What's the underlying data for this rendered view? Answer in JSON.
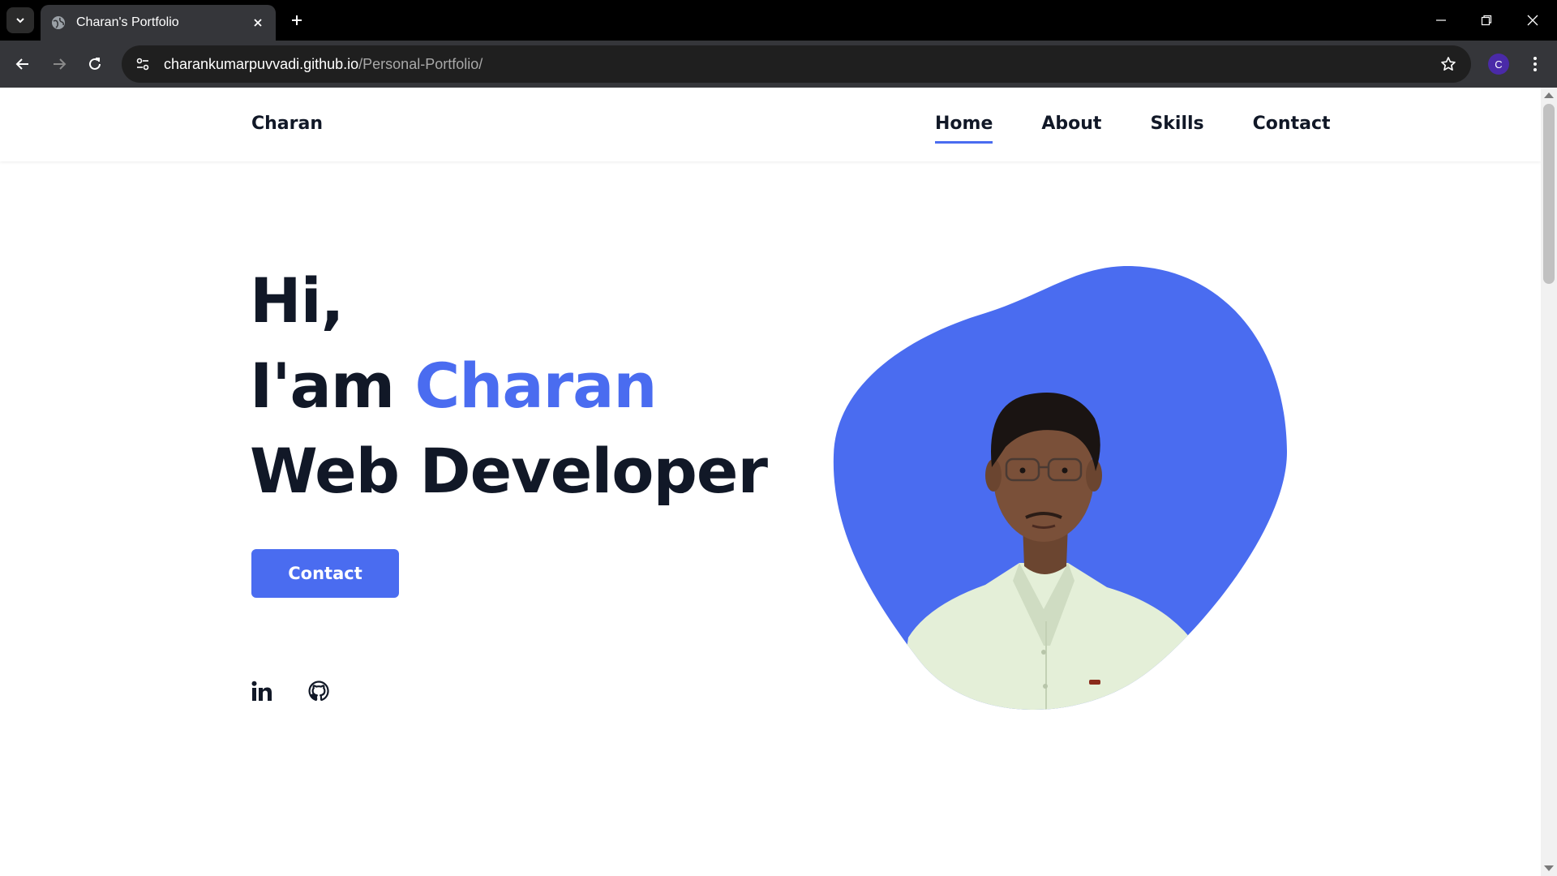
{
  "browser": {
    "tab_title": "Charan's Portfolio",
    "url_host": "charankumarpuvvadi.github.io",
    "url_path": "/Personal-Portfolio/",
    "profile_initial": "C",
    "icons": [
      "tab-search-icon",
      "globe-icon",
      "close-icon",
      "plus-icon",
      "minimize-icon",
      "restore-icon",
      "close-window-icon",
      "back-arrow-icon",
      "forward-arrow-icon",
      "reload-icon",
      "site-info-icon",
      "star-icon",
      "kebab-menu-icon"
    ]
  },
  "header": {
    "brand": "Charan",
    "nav": [
      {
        "label": "Home",
        "active": true
      },
      {
        "label": "About",
        "active": false
      },
      {
        "label": "Skills",
        "active": false
      },
      {
        "label": "Contact",
        "active": false
      }
    ]
  },
  "hero": {
    "greeting": "Hi,",
    "intro_prefix": "I'am ",
    "name": "Charan",
    "role": "Web Developer",
    "cta_label": "Contact",
    "socials": [
      "linkedin-icon",
      "github-icon"
    ]
  },
  "colors": {
    "accent": "#4a6cf0",
    "text": "#111827",
    "chrome_dark": "#35363a",
    "tab_strip": "#000000"
  }
}
